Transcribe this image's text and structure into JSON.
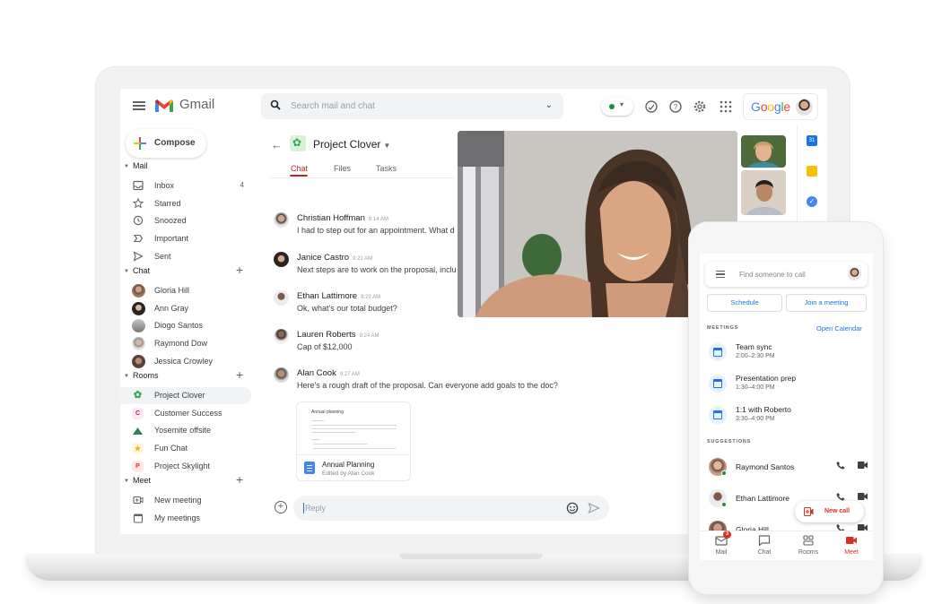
{
  "header": {
    "app_name": "Gmail",
    "search_placeholder": "Search mail and chat",
    "brand": "Google",
    "status": "active",
    "colors": {
      "accent_red": "#c5221f",
      "link_blue": "#1a73e8",
      "online_green": "#1e8e3e"
    }
  },
  "sidebar": {
    "compose_label": "Compose",
    "sections": {
      "mail": "Mail",
      "chat": "Chat",
      "rooms": "Rooms",
      "meet": "Meet"
    },
    "mail_items": [
      {
        "label": "Inbox",
        "count": "4",
        "icon": "inbox-icon"
      },
      {
        "label": "Starred",
        "icon": "star-icon"
      },
      {
        "label": "Snoozed",
        "icon": "clock-icon"
      },
      {
        "label": "Important",
        "icon": "important-icon"
      },
      {
        "label": "Sent",
        "icon": "send-icon"
      }
    ],
    "chat_items": [
      {
        "label": "Gloria Hill",
        "online": true
      },
      {
        "label": "Ann Gray",
        "online": false
      },
      {
        "label": "Diogo Santos",
        "online": false
      },
      {
        "label": "Raymond Dow",
        "online": true
      },
      {
        "label": "Jessica Crowley",
        "online": false
      }
    ],
    "room_items": [
      {
        "label": "Project Clover",
        "icon": "clover-icon",
        "active": true
      },
      {
        "label": "Customer Success",
        "letter": "C"
      },
      {
        "label": "Yosemite offsite",
        "icon": "mountain-icon"
      },
      {
        "label": "Fun Chat",
        "icon": "trophy-icon"
      },
      {
        "label": "Project Skylight",
        "letter": "P"
      }
    ],
    "meet_items": [
      {
        "label": "New meeting",
        "icon": "video-add-icon"
      },
      {
        "label": "My meetings",
        "icon": "calendar-icon"
      }
    ]
  },
  "chat": {
    "room_title": "Project Clover",
    "tabs": [
      "Chat",
      "Files",
      "Tasks"
    ],
    "active_tab": "Chat",
    "messages": [
      {
        "name": "Christian Hoffman",
        "time": "9:14 AM",
        "text": "I had to step out for an appointment. What d"
      },
      {
        "name": "Janice Castro",
        "time": "9:21 AM",
        "text": "Next steps are to work on the proposal, inclu"
      },
      {
        "name": "Ethan Lattimore",
        "time": "9:23 AM",
        "text": "Ok, what's our total budget?"
      },
      {
        "name": "Lauren Roberts",
        "time": "9:24 AM",
        "text": "Cap of $12,000"
      },
      {
        "name": "Alan Cook",
        "time": "9:27 AM",
        "text": "Here's a rough draft of the proposal. Can everyone add goals to the doc?"
      }
    ],
    "attachment": {
      "preview_title": "Annual planning",
      "name": "Annual Planning",
      "subtitle": "Edited by Alan Cook"
    },
    "reply_placeholder": "Reply"
  },
  "phone": {
    "search_placeholder": "Find someone to call",
    "schedule_label": "Schedule",
    "join_label": "Join a meeting",
    "meetings_label": "MEETINGS",
    "open_calendar_label": "Open Calendar",
    "meetings": [
      {
        "title": "Team sync",
        "time": "2:00–2:30 PM"
      },
      {
        "title": "Presentation prep",
        "time": "1:30–4:00 PM"
      },
      {
        "title": "1:1 with Roberto",
        "time": "3:30–4:00 PM"
      }
    ],
    "suggestions_label": "SUGGESTIONS",
    "suggestions": [
      {
        "name": "Raymond Santos",
        "online": true
      },
      {
        "name": "Ethan Lattimore",
        "online": true
      },
      {
        "name": "Gloria Hill",
        "online": false
      }
    ],
    "new_call_label": "New call",
    "bottom_nav": [
      {
        "label": "Mail",
        "badge": "3"
      },
      {
        "label": "Chat"
      },
      {
        "label": "Rooms"
      },
      {
        "label": "Meet",
        "active": true
      }
    ]
  }
}
